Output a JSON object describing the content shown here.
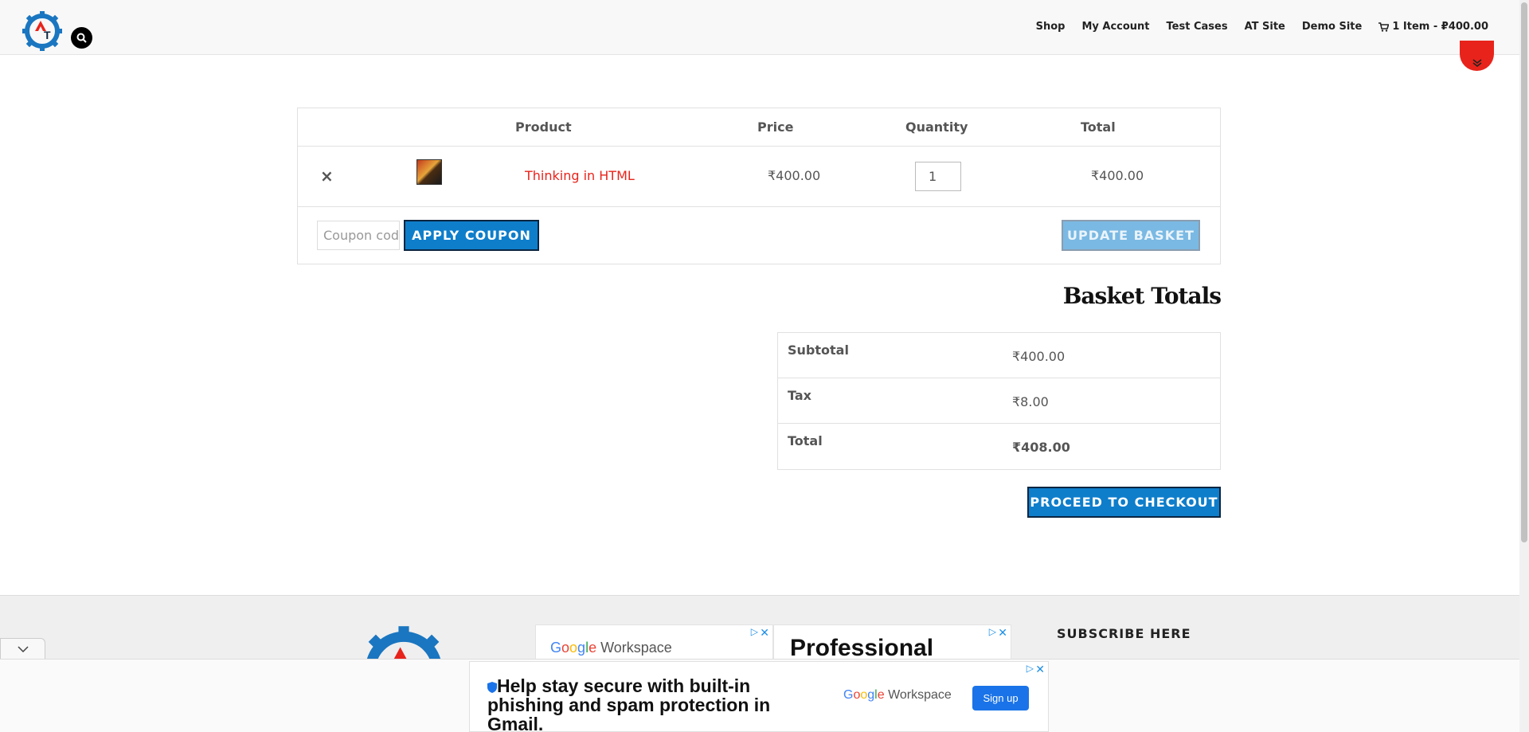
{
  "header": {
    "logo_alt": "AT",
    "nav": [
      "Shop",
      "My Account",
      "Test Cases",
      "AT Site",
      "Demo Site"
    ],
    "cart_summary": "1 Item - ₽400.00"
  },
  "cart": {
    "columns": {
      "product": "Product",
      "price": "Price",
      "quantity": "Quantity",
      "total": "Total"
    },
    "items": [
      {
        "remove": "×",
        "name": "Thinking in HTML",
        "price": "₹400.00",
        "quantity": "1",
        "total": "₹400.00"
      }
    ],
    "coupon_placeholder": "Coupon code",
    "apply_coupon_label": "APPLY COUPON",
    "update_basket_label": "UPDATE BASKET"
  },
  "totals": {
    "title": "Basket Totals",
    "rows": [
      {
        "label": "Subtotal",
        "value": "₹400.00"
      },
      {
        "label": "Tax",
        "value": "₹8.00"
      },
      {
        "label": "Total",
        "value": "₹408.00"
      }
    ],
    "checkout_label": "PROCEED TO CHECKOUT"
  },
  "footer": {
    "subscribe_heading": "SUBSCRIBE HERE",
    "ad1_brand": "Workspace",
    "ad2_text": "Professional"
  },
  "bottom_ad": {
    "headline": "Help stay secure with built-in phishing and spam protection in Gmail.",
    "brand": "Workspace",
    "cta": "Sign up"
  },
  "colors": {
    "accent_red": "#e8231b",
    "button_blue": "#0e7ecb",
    "disabled_blue": "#7ab9e3"
  }
}
